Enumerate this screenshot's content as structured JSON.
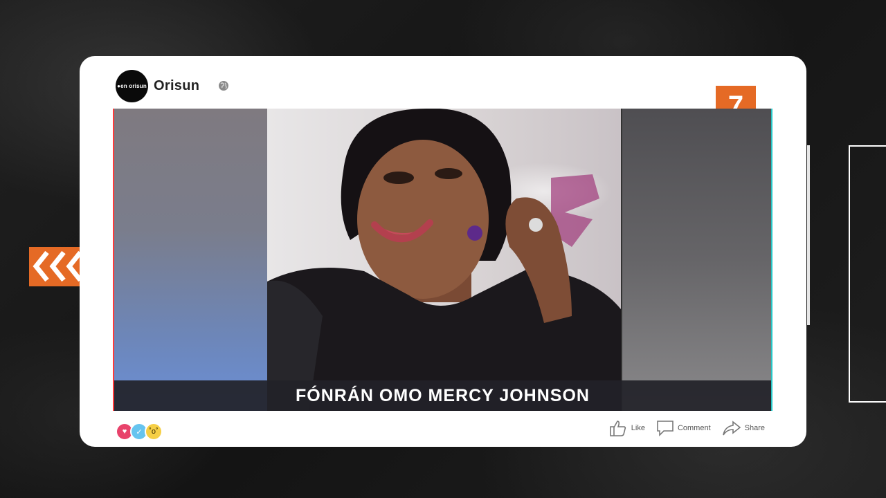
{
  "post": {
    "avatar_text": "●en orisun",
    "page_name": "Orisun",
    "number_badge": "7",
    "caption": "FÓNRÁN OMO MERCY JOHNSON"
  },
  "reactions": [
    {
      "type": "love",
      "icon": "heart-icon",
      "glyph": "♥"
    },
    {
      "type": "like",
      "icon": "thumbs-up-icon",
      "glyph": "✓"
    },
    {
      "type": "wow",
      "icon": "wow-face-icon",
      "glyph": "˚o˚"
    }
  ],
  "actions": {
    "like_label": "Like",
    "comment_label": "Comment",
    "share_label": "Share"
  },
  "colors": {
    "accent": "#e56a25",
    "card": "#ffffff",
    "caption_bar": "#222228"
  }
}
